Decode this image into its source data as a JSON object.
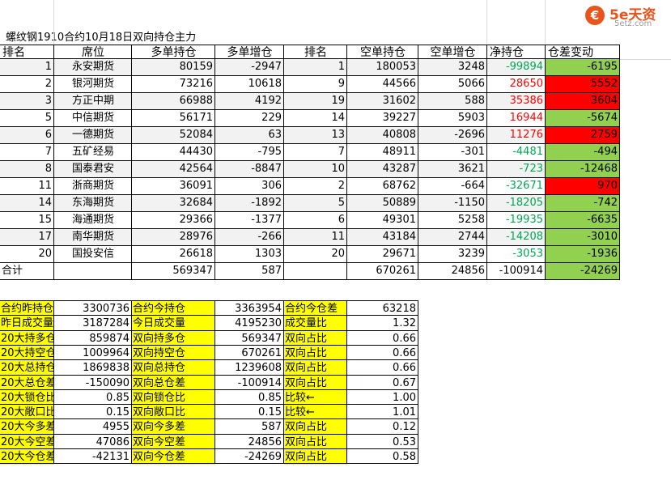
{
  "logo": {
    "icon_char": "€",
    "brand": "5e天资",
    "url": "5etz.com"
  },
  "title": "螺纹钢1910合约10月18日双向持仓主力",
  "headers": [
    "排名",
    "席位",
    "多单持仓",
    "多单增仓",
    "排名",
    "空单持仓",
    "空单增仓",
    "净持仓",
    "仓差变动"
  ],
  "rows": [
    {
      "rank_long": "1",
      "broker": "永安期货",
      "long_pos": "80159",
      "long_chg": "-2947",
      "rank_short": "1",
      "short_pos": "180053",
      "short_chg": "3248",
      "net": "-99894",
      "net_color": "#00a651",
      "diff": "-6195",
      "diff_bg": "#92d050"
    },
    {
      "rank_long": "2",
      "broker": "银河期货",
      "long_pos": "73216",
      "long_chg": "10618",
      "rank_short": "9",
      "short_pos": "44566",
      "short_chg": "5066",
      "net": "28650",
      "net_color": "#ff0000",
      "diff": "5552",
      "diff_bg": "#ff0000"
    },
    {
      "rank_long": "3",
      "broker": "方正中期",
      "long_pos": "66988",
      "long_chg": "4192",
      "rank_short": "19",
      "short_pos": "31602",
      "short_chg": "588",
      "net": "35386",
      "net_color": "#ff0000",
      "diff": "3604",
      "diff_bg": "#ff0000"
    },
    {
      "rank_long": "5",
      "broker": "中信期货",
      "long_pos": "56171",
      "long_chg": "229",
      "rank_short": "14",
      "short_pos": "39227",
      "short_chg": "5903",
      "net": "16944",
      "net_color": "#ff0000",
      "diff": "-5674",
      "diff_bg": "#92d050"
    },
    {
      "rank_long": "6",
      "broker": "一德期货",
      "long_pos": "52084",
      "long_chg": "63",
      "rank_short": "13",
      "short_pos": "40808",
      "short_chg": "-2696",
      "net": "11276",
      "net_color": "#ff0000",
      "diff": "2759",
      "diff_bg": "#ff0000"
    },
    {
      "rank_long": "7",
      "broker": "五矿经易",
      "long_pos": "44430",
      "long_chg": "-795",
      "rank_short": "7",
      "short_pos": "48911",
      "short_chg": "-301",
      "net": "-4481",
      "net_color": "#00a651",
      "diff": "-494",
      "diff_bg": "#92d050"
    },
    {
      "rank_long": "8",
      "broker": "国泰君安",
      "long_pos": "42564",
      "long_chg": "-8847",
      "rank_short": "10",
      "short_pos": "43287",
      "short_chg": "3621",
      "net": "-723",
      "net_color": "#00a651",
      "diff": "-12468",
      "diff_bg": "#92d050"
    },
    {
      "rank_long": "11",
      "broker": "浙商期货",
      "long_pos": "36091",
      "long_chg": "306",
      "rank_short": "2",
      "short_pos": "68762",
      "short_chg": "-664",
      "net": "-32671",
      "net_color": "#00a651",
      "diff": "970",
      "diff_bg": "#ff0000"
    },
    {
      "rank_long": "14",
      "broker": "东海期货",
      "long_pos": "32684",
      "long_chg": "-1892",
      "rank_short": "5",
      "short_pos": "50889",
      "short_chg": "-1150",
      "net": "-18205",
      "net_color": "#00a651",
      "diff": "-742",
      "diff_bg": "#92d050"
    },
    {
      "rank_long": "15",
      "broker": "海通期货",
      "long_pos": "29366",
      "long_chg": "-1377",
      "rank_short": "6",
      "short_pos": "49301",
      "short_chg": "5258",
      "net": "-19935",
      "net_color": "#00a651",
      "diff": "-6635",
      "diff_bg": "#92d050"
    },
    {
      "rank_long": "17",
      "broker": "南华期货",
      "long_pos": "28976",
      "long_chg": "-266",
      "rank_short": "11",
      "short_pos": "43184",
      "short_chg": "2744",
      "net": "-14208",
      "net_color": "#00a651",
      "diff": "-3010",
      "diff_bg": "#92d050"
    },
    {
      "rank_long": "20",
      "broker": "国投安信",
      "long_pos": "26618",
      "long_chg": "1303",
      "rank_short": "20",
      "short_pos": "29671",
      "short_chg": "3239",
      "net": "-3053",
      "net_color": "#00a651",
      "diff": "-1936",
      "diff_bg": "#92d050"
    }
  ],
  "total": {
    "label": "合计",
    "long_pos": "569347",
    "long_chg": "587",
    "short_pos": "670261",
    "short_chg": "24856",
    "net": "-100914",
    "diff": "-24269",
    "diff_bg": "#92d050"
  },
  "summary": [
    {
      "l1": "合约昨持仓",
      "v1": "3300736",
      "l2": "合约今持仓",
      "v2": "3363954",
      "l3": "合约今仓差",
      "v3": "63218"
    },
    {
      "l1": "昨日成交量",
      "v1": "3187284",
      "l2": "今日成交量",
      "v2": "4195230",
      "l3": "成交量比",
      "v3": "1.32"
    },
    {
      "l1": "20大持多仓",
      "v1": "859874",
      "l2": "双向持多仓",
      "v2": "569347",
      "l3": "双向占比",
      "v3": "0.66"
    },
    {
      "l1": "20大持空仓",
      "v1": "1009964",
      "l2": "双向持空仓",
      "v2": "670261",
      "l3": "双向占比",
      "v3": "0.66"
    },
    {
      "l1": "20大总持仓",
      "v1": "1869838",
      "l2": "双向总持仓",
      "v2": "1239608",
      "l3": "双向占比",
      "v3": "0.66"
    },
    {
      "l1": "20大总仓差",
      "v1": "-150090",
      "l2": "双向总仓差",
      "v2": "-100914",
      "l3": "双向占比",
      "v3": "0.67"
    },
    {
      "l1": "20大锁仓比",
      "v1": "0.85",
      "l2": "双向锁仓比",
      "v2": "0.85",
      "l3": "比较←",
      "v3": "1.00"
    },
    {
      "l1": "20大敞口比",
      "v1": "0.15",
      "l2": "双向敞口比",
      "v2": "0.15",
      "l3": "比较←",
      "v3": "1.01"
    },
    {
      "l1": "20大今多差",
      "v1": "4955",
      "l2": "双向今多差",
      "v2": "587",
      "l3": "双向占比",
      "v3": "0.12"
    },
    {
      "l1": "20大今空差",
      "v1": "47086",
      "l2": "双向今空差",
      "v2": "24856",
      "l3": "双向占比",
      "v3": "0.53"
    },
    {
      "l1": "20大今仓差",
      "v1": "-42131",
      "l2": "双向今仓差",
      "v2": "-24269",
      "l3": "双向占比",
      "v3": "0.58"
    }
  ],
  "colors": {
    "yellow": "#ffff00",
    "stripe": "#f2f2f2",
    "red": "#ff0000",
    "green": "#92d050",
    "net_green": "#00a651"
  }
}
